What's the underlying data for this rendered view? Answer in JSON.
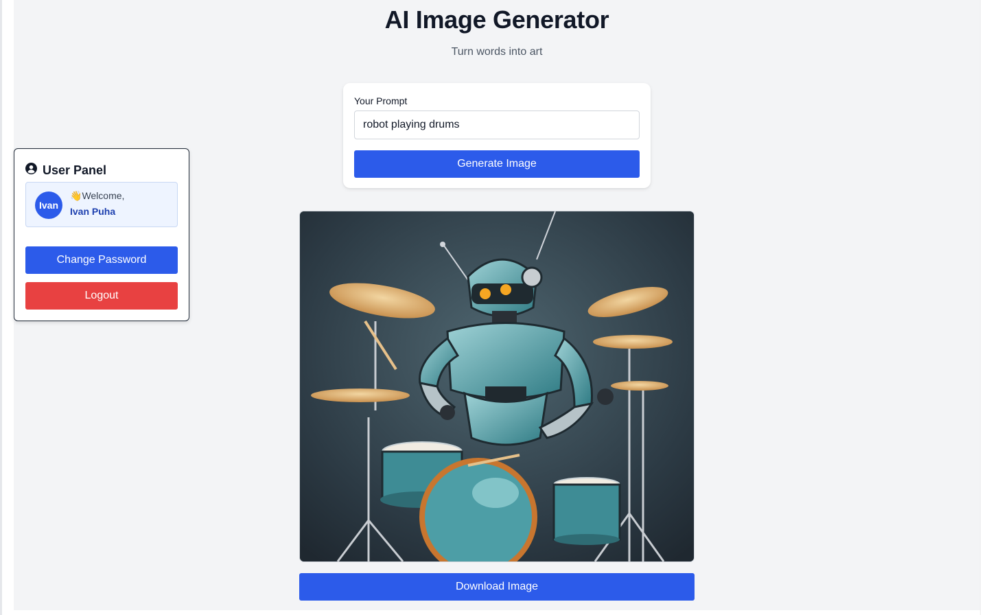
{
  "header": {
    "title": "AI Image Generator",
    "subtitle": "Turn words into art"
  },
  "prompt_form": {
    "label": "Your Prompt",
    "input_value": "robot playing drums",
    "generate_label": "Generate Image"
  },
  "user_panel": {
    "title": "User Panel",
    "avatar_text": "Ivan",
    "welcome_emoji": "👋",
    "welcome_text": "Welcome,",
    "user_name": "Ivan Puha",
    "change_password_label": "Change Password",
    "logout_label": "Logout"
  },
  "result": {
    "image_subject": "robot drummer with teal armor and drum kit",
    "download_label": "Download Image"
  },
  "colors": {
    "primary": "#2c5bea",
    "danger": "#e84141",
    "page_bg": "#f3f4f6",
    "user_card_bg": "#eef4ff",
    "user_name": "#1e40af"
  },
  "icons": {
    "panel_icon": "user-circle-icon"
  }
}
